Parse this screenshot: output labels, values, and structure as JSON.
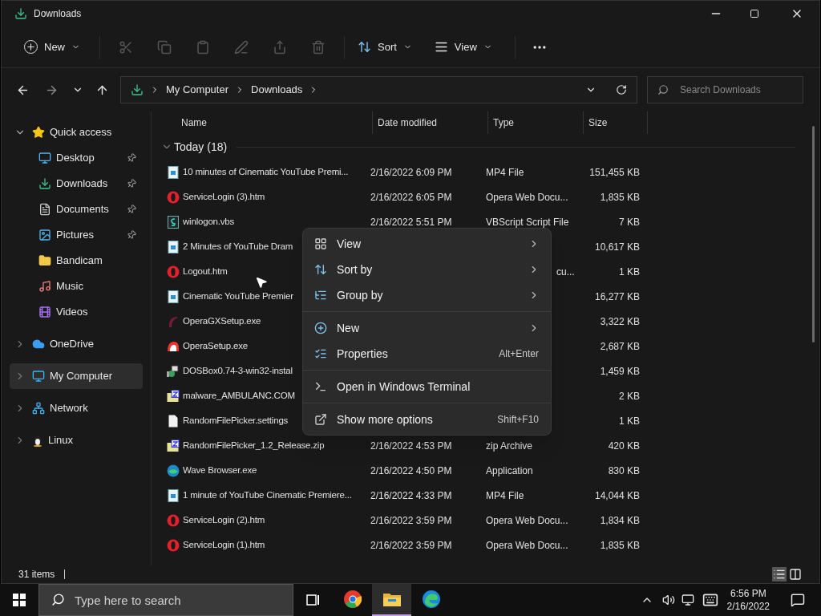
{
  "window": {
    "title": "Downloads"
  },
  "toolbar": {
    "new_label": "New",
    "sort_label": "Sort",
    "view_label": "View"
  },
  "address": {
    "crumbs": [
      "My Computer",
      "Downloads"
    ],
    "search_placeholder": "Search Downloads"
  },
  "sidebar": {
    "items": [
      {
        "label": "Quick access",
        "kind": "star",
        "expanded": true,
        "selected": false,
        "children": [
          {
            "label": "Desktop",
            "kind": "desktop",
            "pinned": true
          },
          {
            "label": "Downloads",
            "kind": "download",
            "pinned": true
          },
          {
            "label": "Documents",
            "kind": "document",
            "pinned": true
          },
          {
            "label": "Pictures",
            "kind": "pictures",
            "pinned": true
          },
          {
            "label": "Bandicam",
            "kind": "folder",
            "pinned": false
          },
          {
            "label": "Music",
            "kind": "music",
            "pinned": false
          },
          {
            "label": "Videos",
            "kind": "videos",
            "pinned": false
          }
        ]
      },
      {
        "label": "OneDrive",
        "kind": "cloud",
        "expanded": false,
        "selected": false
      },
      {
        "label": "My Computer",
        "kind": "computer",
        "expanded": false,
        "selected": true
      },
      {
        "label": "Network",
        "kind": "network",
        "expanded": false,
        "selected": false
      },
      {
        "label": "Linux",
        "kind": "linux",
        "expanded": false,
        "selected": false
      }
    ]
  },
  "table": {
    "columns": [
      "Name",
      "Date modified",
      "Type",
      "Size"
    ],
    "group": {
      "label": "Today (18)",
      "expanded": true
    },
    "rows": [
      {
        "kind": "video",
        "name": "10 minutes of Cinematic YouTube Premi...",
        "date": "2/16/2022 6:09 PM",
        "type": "MP4 File",
        "size": "151,455 KB"
      },
      {
        "kind": "opera",
        "name": "ServiceLogin (3).htm",
        "date": "2/16/2022 6:05 PM",
        "type": "Opera Web Docu...",
        "size": "1,835 KB"
      },
      {
        "kind": "script",
        "name": "winlogon.vbs",
        "date": "2/16/2022 5:51 PM",
        "type": "VBScript Script File",
        "size": "7 KB"
      },
      {
        "kind": "video",
        "name": "2 Minutes of YouTube Dram",
        "size": "10,617 KB"
      },
      {
        "kind": "opera",
        "name": "Logout.htm",
        "type_tail": "cu...",
        "size": "1 KB"
      },
      {
        "kind": "video",
        "name": "Cinematic YouTube Premier",
        "size": "16,277 KB"
      },
      {
        "kind": "operagx",
        "name": "OperaGXSetup.exe",
        "size": "3,322 KB"
      },
      {
        "kind": "operasetup",
        "name": "OperaSetup.exe",
        "size": "2,687 KB"
      },
      {
        "kind": "installer",
        "name": "DOSBox0.74-3-win32-instal",
        "size": "1,459 KB"
      },
      {
        "kind": "zip",
        "name": "malware_AMBULANC.COM",
        "size": "2 KB"
      },
      {
        "kind": "file",
        "name": "RandomFilePicker.settings",
        "size": "1 KB"
      },
      {
        "kind": "zip",
        "name": "RandomFilePicker_1.2_Release.zip",
        "date": "2/16/2022 4:53 PM",
        "type": "zip Archive",
        "size": "420 KB"
      },
      {
        "kind": "wave",
        "name": "Wave Browser.exe",
        "date": "2/16/2022 4:50 PM",
        "type": "Application",
        "size": "830 KB"
      },
      {
        "kind": "video",
        "name": "1 minute of YouTube Cinematic Premiere...",
        "date": "2/16/2022 4:33 PM",
        "type": "MP4 File",
        "size": "14,044 KB"
      },
      {
        "kind": "opera",
        "name": "ServiceLogin (2).htm",
        "date": "2/16/2022 3:59 PM",
        "type": "Opera Web Docu...",
        "size": "1,834 KB"
      },
      {
        "kind": "opera",
        "name": "ServiceLogin (1).htm",
        "date": "2/16/2022 3:59 PM",
        "type": "Opera Web Docu...",
        "size": "1,835 KB"
      }
    ]
  },
  "context_menu": {
    "items": [
      {
        "kind": "view",
        "label": "View",
        "submenu": true
      },
      {
        "kind": "sort",
        "label": "Sort by",
        "submenu": true
      },
      {
        "kind": "group",
        "label": "Group by",
        "submenu": true,
        "divider_after": true
      },
      {
        "kind": "new",
        "label": "New",
        "submenu": true
      },
      {
        "kind": "properties",
        "label": "Properties",
        "shortcut": "Alt+Enter",
        "divider_after": true
      },
      {
        "kind": "terminal",
        "label": "Open in Windows Terminal",
        "divider_after": true
      },
      {
        "kind": "more",
        "label": "Show more options",
        "shortcut": "Shift+F10"
      }
    ]
  },
  "status_bar": {
    "count": "31 items",
    "views": [
      {
        "kind": "details",
        "selected": true
      },
      {
        "kind": "preview",
        "selected": false
      }
    ]
  },
  "taskbar": {
    "search_placeholder": "Type here to search",
    "time": "6:56 PM",
    "date": "2/16/2022",
    "apps": [
      {
        "kind": "chrome",
        "selected": false
      },
      {
        "kind": "explorer",
        "selected": true
      },
      {
        "kind": "edge",
        "selected": false
      }
    ]
  }
}
